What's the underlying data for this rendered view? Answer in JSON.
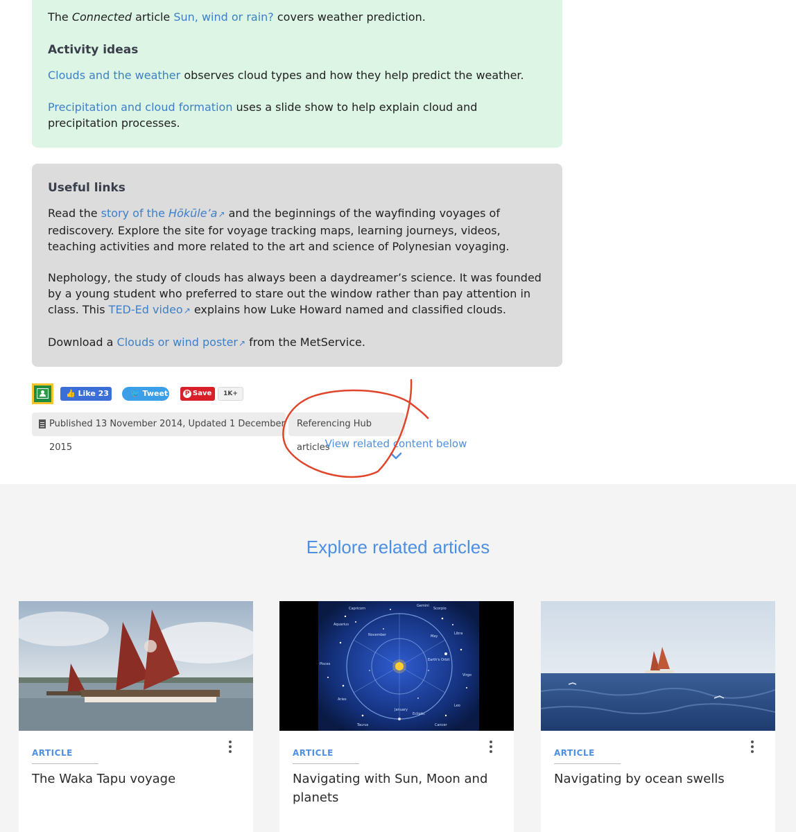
{
  "top_box": {
    "line1": {
      "pre": "The ",
      "italic": "Connected",
      "mid": " article ",
      "link": "Sun, wind or rain?",
      "post": " covers weather prediction."
    },
    "heading": "Activity ideas",
    "idea1": {
      "link": "Clouds and the weather",
      "post": " observes cloud types and how they help predict the weather."
    },
    "idea2": {
      "link": "Precipitation and cloud formation",
      "post": " uses a slide show to help explain cloud and precipitation processes."
    }
  },
  "useful_links": {
    "heading": "Useful links",
    "p1": {
      "pre": "Read the ",
      "link": "story of the ",
      "link_italic": "Hōkūle’a",
      "post": " and the beginnings of the wayfinding voyages of rediscovery. Explore the site for voyage tracking maps, learning journeys, videos, teaching activities and more related to the art and science of Polynesian voyaging."
    },
    "p2": {
      "pre": "Nephology, the study of clouds has always been a daydreamer’s science. It was founded by a young student who preferred to stare out the window rather than pay attention in class. This ",
      "link": "TED-Ed video",
      "post": " explains how Luke Howard named and classified clouds."
    },
    "p3": {
      "pre": "Download a ",
      "link": "Clouds or wind poster",
      "post": " from the MetService."
    }
  },
  "social": {
    "fb_label": "Like 23",
    "tweet_label": "Tweet",
    "save_label": "Save",
    "count_label": "1K+"
  },
  "meta": {
    "published": "Published 13 November 2014, Updated 1 December 2015",
    "referencing": "Referencing Hub articles",
    "view_related": "View related content below"
  },
  "related": {
    "title": "Explore related articles",
    "cards": [
      {
        "tag": "ARTICLE",
        "title": "The Waka Tapu voyage"
      },
      {
        "tag": "ARTICLE",
        "title": "Navigating with Sun, Moon and planets"
      },
      {
        "tag": "ARTICLE",
        "title": "Navigating by ocean swells"
      }
    ]
  },
  "colors": {
    "link": "#3d80c8",
    "accent": "#4d8fe0",
    "annotation": "#e0452b",
    "green_box": "#dcf5e4",
    "grey_box": "#dcdcdc"
  },
  "image_labels": {
    "constellations": [
      "Capricorn",
      "Scorpio",
      "Aquarius",
      "Libra",
      "Pisces",
      "Virgo",
      "Aries",
      "Leo",
      "Taurus",
      "Cancer",
      "Gemini",
      "January",
      "Earth's Orbit",
      "Ecliptic",
      "November",
      "May"
    ]
  }
}
